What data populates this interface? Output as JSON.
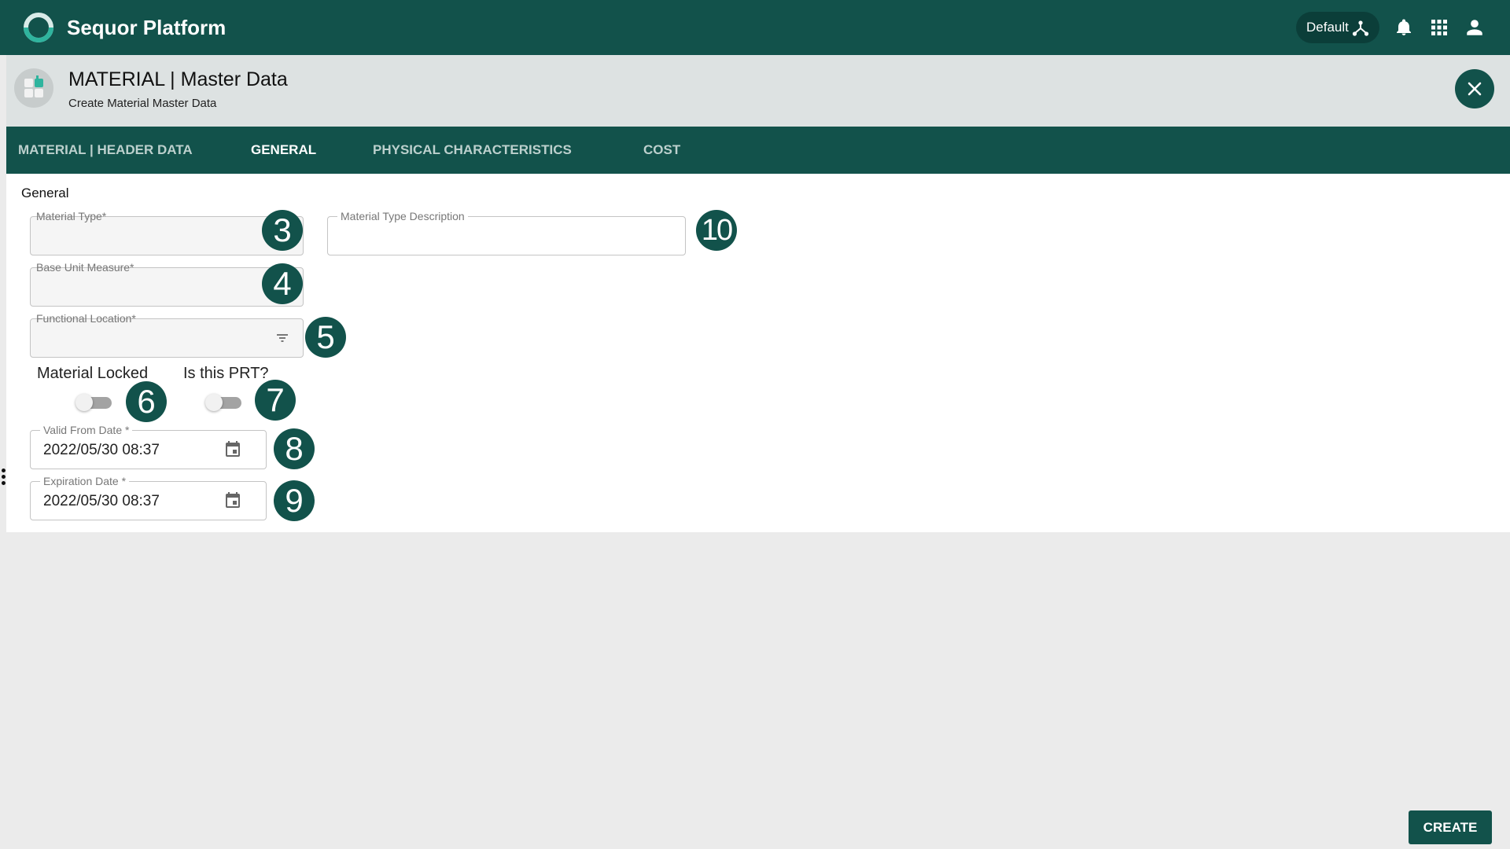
{
  "app": {
    "title": "Sequor Platform"
  },
  "topbar": {
    "profile_label": "Default",
    "icons": [
      "hierarchy-icon",
      "bell-icon",
      "apps-grid-icon",
      "user-icon"
    ]
  },
  "header": {
    "title": "MATERIAL | Master Data",
    "subtitle": "Create Material Master Data"
  },
  "tabs": [
    {
      "label": "MATERIAL | HEADER DATA",
      "active": false
    },
    {
      "label": "GENERAL",
      "active": true
    },
    {
      "label": "PHYSICAL CHARACTERISTICS",
      "active": false
    },
    {
      "label": "COST",
      "active": false
    }
  ],
  "section": {
    "title": "General"
  },
  "fields": {
    "material_type": {
      "label": "Material Type*",
      "value": "",
      "badge": "3"
    },
    "material_type_description": {
      "label": "Material Type Description",
      "value": "",
      "badge": "10"
    },
    "base_unit_measure": {
      "label": "Base Unit Measure*",
      "value": "",
      "badge": "4"
    },
    "functional_location": {
      "label": "Functional Location*",
      "value": "",
      "badge": "5"
    },
    "material_locked": {
      "label": "Material Locked",
      "checked": false,
      "badge": "6"
    },
    "is_prt": {
      "label": "Is this PRT?",
      "checked": false,
      "badge": "7"
    },
    "valid_from_date": {
      "label": "Valid From Date *",
      "value": "2022/05/30 08:37",
      "badge": "8"
    },
    "expiration_date": {
      "label": "Expiration Date *",
      "value": "2022/05/30 08:37",
      "badge": "9"
    }
  },
  "actions": {
    "create_label": "CREATE"
  },
  "colors": {
    "brand": "#12524b",
    "brand_dark": "#0b3e39",
    "header_bg": "#dde2e2",
    "page_bg": "#ebebeb"
  }
}
